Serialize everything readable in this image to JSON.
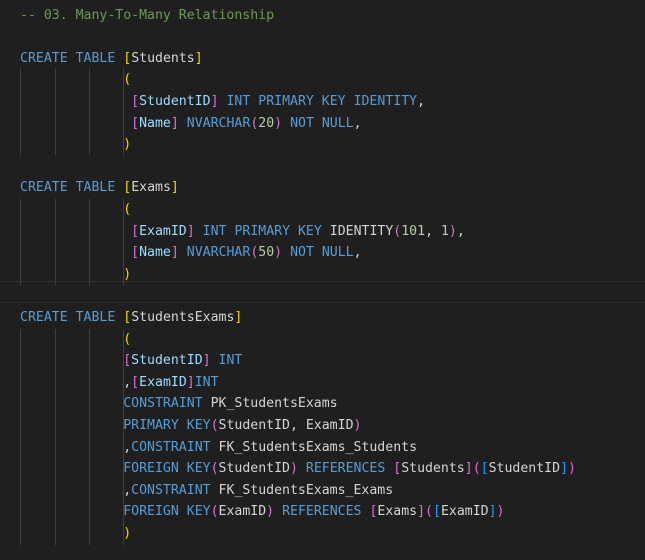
{
  "editor": {
    "lines": [
      {
        "id": "l1",
        "tokens": [
          {
            "t": "-- 03. Many-To-Many Relationship",
            "c": "cm"
          }
        ]
      },
      {
        "id": "l2",
        "tokens": []
      },
      {
        "id": "l3",
        "tokens": [
          {
            "t": "CREATE",
            "c": "k"
          },
          {
            "t": " ",
            "c": "p"
          },
          {
            "t": "TABLE",
            "c": "k"
          },
          {
            "t": " ",
            "c": "p"
          },
          {
            "t": "[",
            "c": "bl"
          },
          {
            "t": "Students",
            "c": "p"
          },
          {
            "t": "]",
            "c": "bl"
          }
        ]
      },
      {
        "id": "l4",
        "tokens": [
          {
            "t": "             ",
            "c": "p"
          },
          {
            "t": "(",
            "c": "bl"
          }
        ]
      },
      {
        "id": "l5",
        "tokens": [
          {
            "t": "              ",
            "c": "p"
          },
          {
            "t": "[",
            "c": "bp"
          },
          {
            "t": "StudentID",
            "c": "id"
          },
          {
            "t": "]",
            "c": "bp"
          },
          {
            "t": " ",
            "c": "p"
          },
          {
            "t": "INT",
            "c": "k"
          },
          {
            "t": " ",
            "c": "p"
          },
          {
            "t": "PRIMARY",
            "c": "k"
          },
          {
            "t": " ",
            "c": "p"
          },
          {
            "t": "KEY",
            "c": "k"
          },
          {
            "t": " ",
            "c": "p"
          },
          {
            "t": "IDENTITY",
            "c": "k"
          },
          {
            "t": ",",
            "c": "p"
          }
        ]
      },
      {
        "id": "l6",
        "tokens": [
          {
            "t": "              ",
            "c": "p"
          },
          {
            "t": "[",
            "c": "bp"
          },
          {
            "t": "Name",
            "c": "id"
          },
          {
            "t": "]",
            "c": "bp"
          },
          {
            "t": " ",
            "c": "p"
          },
          {
            "t": "NVARCHAR",
            "c": "k"
          },
          {
            "t": "(",
            "c": "bp"
          },
          {
            "t": "20",
            "c": "n"
          },
          {
            "t": ")",
            "c": "bp"
          },
          {
            "t": " ",
            "c": "p"
          },
          {
            "t": "NOT",
            "c": "k"
          },
          {
            "t": " ",
            "c": "p"
          },
          {
            "t": "NULL",
            "c": "k"
          },
          {
            "t": ",",
            "c": "p"
          }
        ]
      },
      {
        "id": "l7",
        "tokens": [
          {
            "t": "             ",
            "c": "p"
          },
          {
            "t": ")",
            "c": "bl"
          }
        ]
      },
      {
        "id": "l8",
        "tokens": []
      },
      {
        "id": "l9",
        "tokens": [
          {
            "t": "CREATE",
            "c": "k"
          },
          {
            "t": " ",
            "c": "p"
          },
          {
            "t": "TABLE",
            "c": "k"
          },
          {
            "t": " ",
            "c": "p"
          },
          {
            "t": "[",
            "c": "bl"
          },
          {
            "t": "Exams",
            "c": "p"
          },
          {
            "t": "]",
            "c": "bl"
          }
        ]
      },
      {
        "id": "l10",
        "tokens": [
          {
            "t": "             ",
            "c": "p"
          },
          {
            "t": "(",
            "c": "bl"
          }
        ]
      },
      {
        "id": "l11",
        "tokens": [
          {
            "t": "              ",
            "c": "p"
          },
          {
            "t": "[",
            "c": "bp"
          },
          {
            "t": "ExamID",
            "c": "id"
          },
          {
            "t": "]",
            "c": "bp"
          },
          {
            "t": " ",
            "c": "p"
          },
          {
            "t": "INT",
            "c": "k"
          },
          {
            "t": " ",
            "c": "p"
          },
          {
            "t": "PRIMARY",
            "c": "k"
          },
          {
            "t": " ",
            "c": "p"
          },
          {
            "t": "KEY",
            "c": "k"
          },
          {
            "t": " ",
            "c": "p"
          },
          {
            "t": "IDENTITY",
            "c": "p"
          },
          {
            "t": "(",
            "c": "bp"
          },
          {
            "t": "101",
            "c": "n"
          },
          {
            "t": ", ",
            "c": "p"
          },
          {
            "t": "1",
            "c": "n"
          },
          {
            "t": ")",
            "c": "bp"
          },
          {
            "t": ",",
            "c": "p"
          }
        ]
      },
      {
        "id": "l12",
        "tokens": [
          {
            "t": "              ",
            "c": "p"
          },
          {
            "t": "[",
            "c": "bp"
          },
          {
            "t": "Name",
            "c": "id"
          },
          {
            "t": "]",
            "c": "bp"
          },
          {
            "t": " ",
            "c": "p"
          },
          {
            "t": "NVARCHAR",
            "c": "k"
          },
          {
            "t": "(",
            "c": "bp"
          },
          {
            "t": "50",
            "c": "n"
          },
          {
            "t": ")",
            "c": "bp"
          },
          {
            "t": " ",
            "c": "p"
          },
          {
            "t": "NOT",
            "c": "k"
          },
          {
            "t": " ",
            "c": "p"
          },
          {
            "t": "NULL",
            "c": "k"
          },
          {
            "t": ",",
            "c": "p"
          }
        ]
      },
      {
        "id": "l13",
        "tokens": [
          {
            "t": "             ",
            "c": "p"
          },
          {
            "t": ")",
            "c": "bl"
          }
        ]
      },
      {
        "id": "l14",
        "tokens": []
      },
      {
        "id": "l15",
        "tokens": [
          {
            "t": "CREATE",
            "c": "k"
          },
          {
            "t": " ",
            "c": "p"
          },
          {
            "t": "TABLE",
            "c": "k"
          },
          {
            "t": " ",
            "c": "p"
          },
          {
            "t": "[",
            "c": "bl"
          },
          {
            "t": "StudentsExams",
            "c": "p"
          },
          {
            "t": "]",
            "c": "bl"
          }
        ]
      },
      {
        "id": "l16",
        "tokens": [
          {
            "t": "             ",
            "c": "p"
          },
          {
            "t": "(",
            "c": "bl"
          }
        ]
      },
      {
        "id": "l17",
        "tokens": [
          {
            "t": "             ",
            "c": "p"
          },
          {
            "t": "[",
            "c": "bp"
          },
          {
            "t": "StudentID",
            "c": "id"
          },
          {
            "t": "]",
            "c": "bp"
          },
          {
            "t": " ",
            "c": "p"
          },
          {
            "t": "INT",
            "c": "k"
          }
        ]
      },
      {
        "id": "l18",
        "tokens": [
          {
            "t": "             ",
            "c": "p"
          },
          {
            "t": ",",
            "c": "p"
          },
          {
            "t": "[",
            "c": "bp"
          },
          {
            "t": "ExamID",
            "c": "id"
          },
          {
            "t": "]",
            "c": "bp"
          },
          {
            "t": "INT",
            "c": "k"
          }
        ]
      },
      {
        "id": "l19",
        "tokens": [
          {
            "t": "             ",
            "c": "p"
          },
          {
            "t": "CONSTRAINT",
            "c": "k"
          },
          {
            "t": " PK_StudentsExams",
            "c": "p"
          }
        ]
      },
      {
        "id": "l20",
        "tokens": [
          {
            "t": "             ",
            "c": "p"
          },
          {
            "t": "PRIMARY",
            "c": "k"
          },
          {
            "t": " ",
            "c": "p"
          },
          {
            "t": "KEY",
            "c": "k"
          },
          {
            "t": "(",
            "c": "bp"
          },
          {
            "t": "StudentID, ExamID",
            "c": "p"
          },
          {
            "t": ")",
            "c": "bp"
          }
        ]
      },
      {
        "id": "l21",
        "tokens": [
          {
            "t": "             ",
            "c": "p"
          },
          {
            "t": ",",
            "c": "p"
          },
          {
            "t": "CONSTRAINT",
            "c": "k"
          },
          {
            "t": " FK_StudentsExams_Students",
            "c": "p"
          }
        ]
      },
      {
        "id": "l22",
        "tokens": [
          {
            "t": "             ",
            "c": "p"
          },
          {
            "t": "FOREIGN",
            "c": "k"
          },
          {
            "t": " ",
            "c": "p"
          },
          {
            "t": "KEY",
            "c": "k"
          },
          {
            "t": "(",
            "c": "bp"
          },
          {
            "t": "StudentID",
            "c": "p"
          },
          {
            "t": ")",
            "c": "bp"
          },
          {
            "t": " ",
            "c": "p"
          },
          {
            "t": "REFERENCES",
            "c": "k"
          },
          {
            "t": " ",
            "c": "p"
          },
          {
            "t": "[",
            "c": "bp"
          },
          {
            "t": "Students",
            "c": "p"
          },
          {
            "t": "]",
            "c": "bp"
          },
          {
            "t": "(",
            "c": "bp"
          },
          {
            "t": "[",
            "c": "bb"
          },
          {
            "t": "StudentID",
            "c": "p"
          },
          {
            "t": "]",
            "c": "bb"
          },
          {
            "t": ")",
            "c": "bp"
          }
        ]
      },
      {
        "id": "l23",
        "tokens": [
          {
            "t": "             ",
            "c": "p"
          },
          {
            "t": ",",
            "c": "p"
          },
          {
            "t": "CONSTRAINT",
            "c": "k"
          },
          {
            "t": " FK_StudentsExams_Exams",
            "c": "p"
          }
        ]
      },
      {
        "id": "l24",
        "tokens": [
          {
            "t": "             ",
            "c": "p"
          },
          {
            "t": "FOREIGN",
            "c": "k"
          },
          {
            "t": " ",
            "c": "p"
          },
          {
            "t": "KEY",
            "c": "k"
          },
          {
            "t": "(",
            "c": "bp"
          },
          {
            "t": "ExamID",
            "c": "p"
          },
          {
            "t": ")",
            "c": "bp"
          },
          {
            "t": " ",
            "c": "p"
          },
          {
            "t": "REFERENCES",
            "c": "k"
          },
          {
            "t": " ",
            "c": "p"
          },
          {
            "t": "[",
            "c": "bp"
          },
          {
            "t": "Exams",
            "c": "p"
          },
          {
            "t": "]",
            "c": "bp"
          },
          {
            "t": "(",
            "c": "bp"
          },
          {
            "t": "[",
            "c": "bb"
          },
          {
            "t": "ExamID",
            "c": "p"
          },
          {
            "t": "]",
            "c": "bb"
          },
          {
            "t": ")",
            "c": "bp"
          }
        ]
      },
      {
        "id": "l25",
        "tokens": [
          {
            "t": "             ",
            "c": "p"
          },
          {
            "t": ")",
            "c": "bl"
          }
        ]
      }
    ]
  }
}
